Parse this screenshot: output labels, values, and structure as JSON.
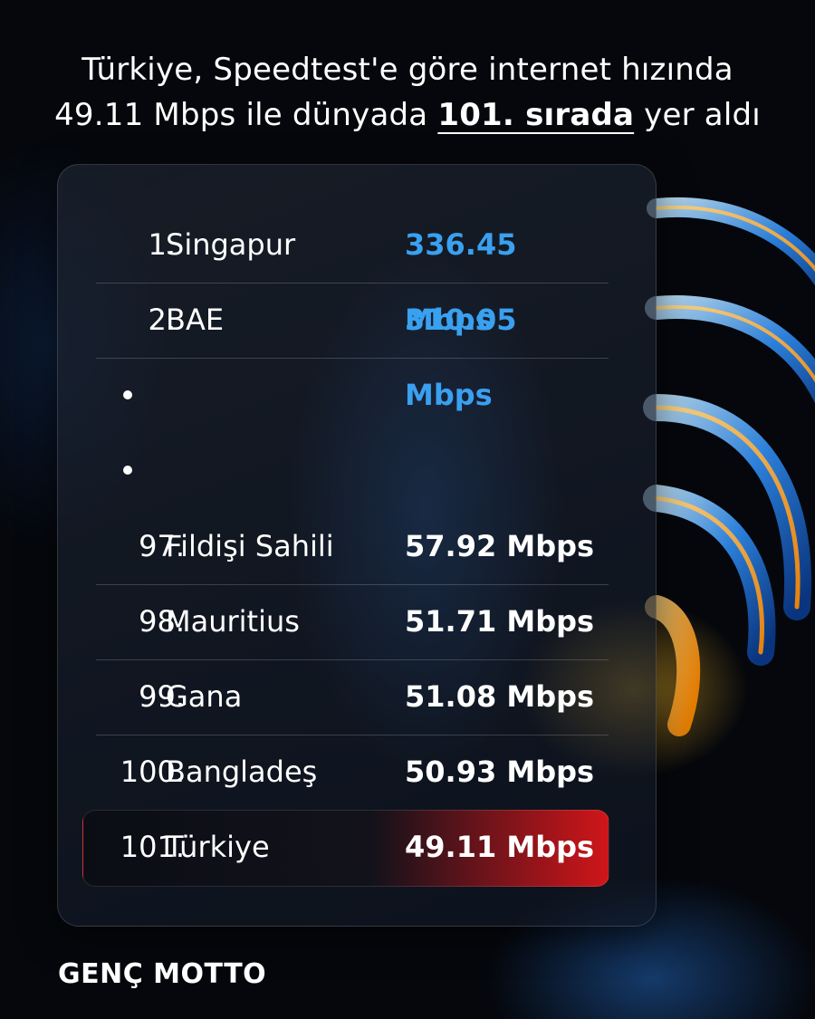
{
  "headline": {
    "line1": "Türkiye, Speedtest'e göre internet hızında",
    "line2_prefix": "49.11 Mbps ile dünyada ",
    "line2_emphasis": "101. sırada",
    "line2_suffix": " yer aldı"
  },
  "ranking": {
    "top": [
      {
        "rank": "1.",
        "country": "Singapur",
        "speed": "336.45 Mbps"
      },
      {
        "rank": "2.",
        "country": "BAE",
        "speed": "310.05 Mbps"
      }
    ],
    "bottom": [
      {
        "rank": "97.",
        "country": "Fildişi Sahili",
        "speed": "57.92 Mbps"
      },
      {
        "rank": "98.",
        "country": "Mauritius",
        "speed": "51.71 Mbps"
      },
      {
        "rank": "99.",
        "country": "Gana",
        "speed": "51.08 Mbps"
      },
      {
        "rank": "100.",
        "country": "Bangladeş",
        "speed": "50.93 Mbps"
      },
      {
        "rank": "101.",
        "country": "Türkiye",
        "speed": "49.11 Mbps"
      }
    ]
  },
  "colors": {
    "top_speed": "#3aa0f0",
    "highlight": "#d0161a"
  },
  "brand": {
    "name": "GENÇ MOTTO"
  },
  "decoration": {
    "icon": "wifi-signal-icon"
  }
}
